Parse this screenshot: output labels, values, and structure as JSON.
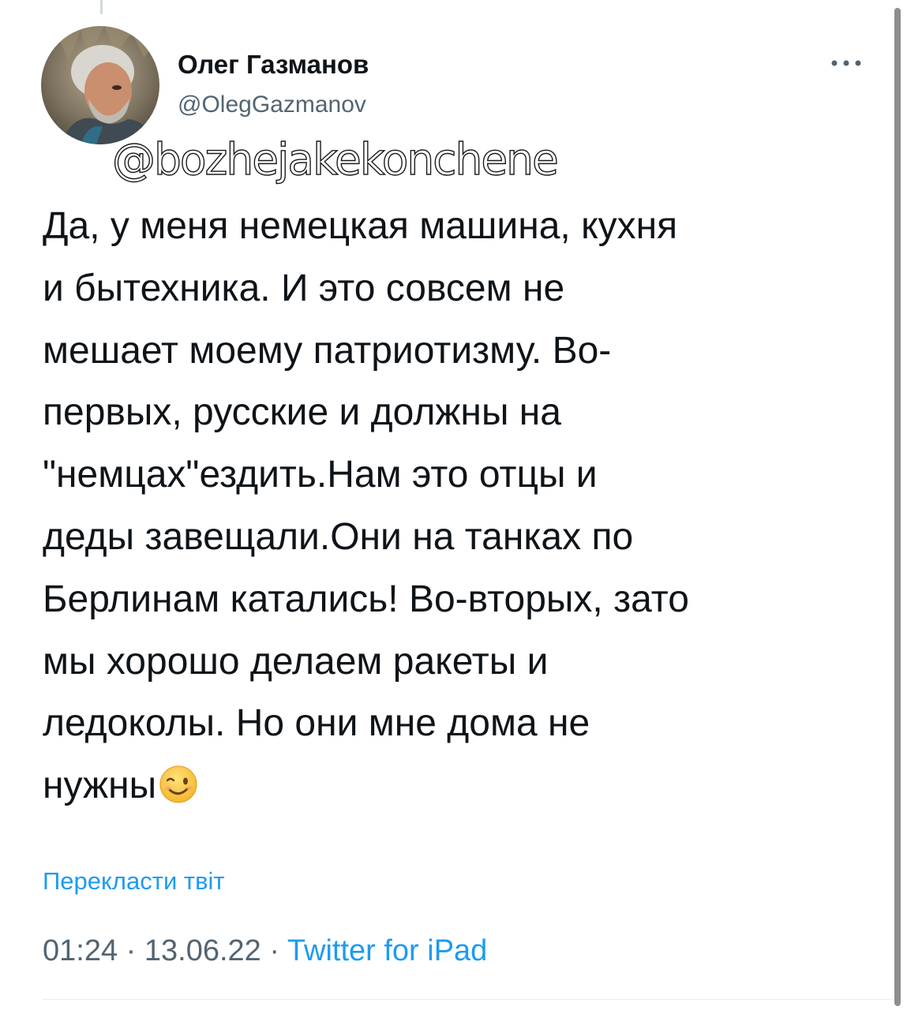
{
  "tweet": {
    "display_name": "Олег Газманов",
    "handle": "@OlegGazmanov",
    "text": "Да, у меня немецкая машина, кухня\nи бытехника. И это совсем не\nмешает моему патриотизму. Во-\nпервых, русские и должны на\n\"немцах\"ездить.Нам это отцы и\nдеды завещали.Они на танках по\nБерлинам катались! Во-вторых, зато\nмы хорошо делаем ракеты и\nледоколы. Но они мне дома не\nнужны",
    "emoji": "winking-face",
    "translate_label": "Перекласти твіт",
    "time": "01:24",
    "date": "13.06.22",
    "separator": "·",
    "source": "Twitter for iPad"
  },
  "watermark": {
    "text": "@bozhejakekonchene"
  },
  "icons": {
    "more": "more-dots-icon",
    "avatar": "profile-photo"
  },
  "colors": {
    "text": "#0f1419",
    "secondary": "#536471",
    "link": "#1d9bf0",
    "background": "#ffffff"
  }
}
